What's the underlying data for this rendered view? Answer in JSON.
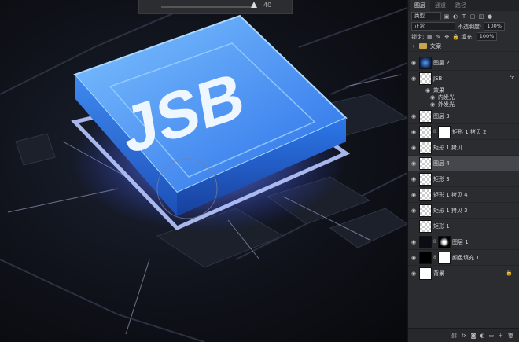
{
  "canvas": {
    "chip_label": "JSB",
    "float_bar_value": "40"
  },
  "panel": {
    "tabs": [
      {
        "label": "图层"
      },
      {
        "label": "通道"
      },
      {
        "label": "路径"
      }
    ],
    "filter_kind": "类型",
    "blend_mode": "正常",
    "opacity_label": "不透明度:",
    "opacity_value": "100%",
    "lock_label": "锁定:",
    "fill_label": "填充:",
    "fill_value": "100%",
    "group_layer": "文案",
    "layers": [
      {
        "name": "图层 2",
        "thumb": "blue",
        "fx": ""
      },
      {
        "name": "JSB",
        "thumb": "checker",
        "fx": "fx"
      },
      {
        "name": "图层 3",
        "thumb": "checker",
        "fx": ""
      },
      {
        "name": "矩形 1 拷贝 2",
        "thumb": "checker",
        "fx": ""
      },
      {
        "name": "矩形 1 拷贝",
        "thumb": "checker",
        "fx": ""
      },
      {
        "name": "图层 4",
        "thumb": "checker",
        "fx": ""
      },
      {
        "name": "矩形 3",
        "thumb": "checker",
        "fx": ""
      },
      {
        "name": "矩形 1 拷贝 4",
        "thumb": "checker",
        "fx": ""
      },
      {
        "name": "矩形 1 拷贝 3",
        "thumb": "checker",
        "fx": ""
      },
      {
        "name": "矩形 1",
        "thumb": "checker",
        "fx": ""
      },
      {
        "name": "图层 1",
        "thumb": "dark",
        "fx": ""
      },
      {
        "name": "颜色填充 1",
        "thumb": "black",
        "fx": ""
      },
      {
        "name": "背景",
        "thumb": "white",
        "fx": ""
      }
    ],
    "effects_label": "效果",
    "effect_inner_glow": "内发光",
    "effect_outer_glow": "外发光",
    "bottom_icons": [
      "link-icon",
      "fx-icon",
      "mask-icon",
      "adjustment-icon",
      "folder-icon",
      "new-layer-icon",
      "trash-icon"
    ],
    "accent_selected": "#45474c"
  }
}
